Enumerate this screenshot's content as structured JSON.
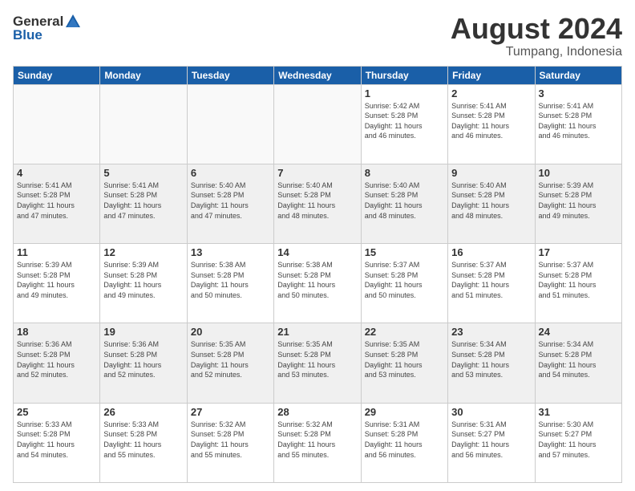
{
  "header": {
    "logo_general": "General",
    "logo_blue": "Blue",
    "month": "August 2024",
    "location": "Tumpang, Indonesia"
  },
  "days_of_week": [
    "Sunday",
    "Monday",
    "Tuesday",
    "Wednesday",
    "Thursday",
    "Friday",
    "Saturday"
  ],
  "weeks": [
    [
      {
        "day": "",
        "info": "",
        "empty": true
      },
      {
        "day": "",
        "info": "",
        "empty": true
      },
      {
        "day": "",
        "info": "",
        "empty": true
      },
      {
        "day": "",
        "info": "",
        "empty": true
      },
      {
        "day": "1",
        "info": "Sunrise: 5:42 AM\nSunset: 5:28 PM\nDaylight: 11 hours\nand 46 minutes."
      },
      {
        "day": "2",
        "info": "Sunrise: 5:41 AM\nSunset: 5:28 PM\nDaylight: 11 hours\nand 46 minutes."
      },
      {
        "day": "3",
        "info": "Sunrise: 5:41 AM\nSunset: 5:28 PM\nDaylight: 11 hours\nand 46 minutes."
      }
    ],
    [
      {
        "day": "4",
        "info": "Sunrise: 5:41 AM\nSunset: 5:28 PM\nDaylight: 11 hours\nand 47 minutes."
      },
      {
        "day": "5",
        "info": "Sunrise: 5:41 AM\nSunset: 5:28 PM\nDaylight: 11 hours\nand 47 minutes."
      },
      {
        "day": "6",
        "info": "Sunrise: 5:40 AM\nSunset: 5:28 PM\nDaylight: 11 hours\nand 47 minutes."
      },
      {
        "day": "7",
        "info": "Sunrise: 5:40 AM\nSunset: 5:28 PM\nDaylight: 11 hours\nand 48 minutes."
      },
      {
        "day": "8",
        "info": "Sunrise: 5:40 AM\nSunset: 5:28 PM\nDaylight: 11 hours\nand 48 minutes."
      },
      {
        "day": "9",
        "info": "Sunrise: 5:40 AM\nSunset: 5:28 PM\nDaylight: 11 hours\nand 48 minutes."
      },
      {
        "day": "10",
        "info": "Sunrise: 5:39 AM\nSunset: 5:28 PM\nDaylight: 11 hours\nand 49 minutes."
      }
    ],
    [
      {
        "day": "11",
        "info": "Sunrise: 5:39 AM\nSunset: 5:28 PM\nDaylight: 11 hours\nand 49 minutes."
      },
      {
        "day": "12",
        "info": "Sunrise: 5:39 AM\nSunset: 5:28 PM\nDaylight: 11 hours\nand 49 minutes."
      },
      {
        "day": "13",
        "info": "Sunrise: 5:38 AM\nSunset: 5:28 PM\nDaylight: 11 hours\nand 50 minutes."
      },
      {
        "day": "14",
        "info": "Sunrise: 5:38 AM\nSunset: 5:28 PM\nDaylight: 11 hours\nand 50 minutes."
      },
      {
        "day": "15",
        "info": "Sunrise: 5:37 AM\nSunset: 5:28 PM\nDaylight: 11 hours\nand 50 minutes."
      },
      {
        "day": "16",
        "info": "Sunrise: 5:37 AM\nSunset: 5:28 PM\nDaylight: 11 hours\nand 51 minutes."
      },
      {
        "day": "17",
        "info": "Sunrise: 5:37 AM\nSunset: 5:28 PM\nDaylight: 11 hours\nand 51 minutes."
      }
    ],
    [
      {
        "day": "18",
        "info": "Sunrise: 5:36 AM\nSunset: 5:28 PM\nDaylight: 11 hours\nand 52 minutes."
      },
      {
        "day": "19",
        "info": "Sunrise: 5:36 AM\nSunset: 5:28 PM\nDaylight: 11 hours\nand 52 minutes."
      },
      {
        "day": "20",
        "info": "Sunrise: 5:35 AM\nSunset: 5:28 PM\nDaylight: 11 hours\nand 52 minutes."
      },
      {
        "day": "21",
        "info": "Sunrise: 5:35 AM\nSunset: 5:28 PM\nDaylight: 11 hours\nand 53 minutes."
      },
      {
        "day": "22",
        "info": "Sunrise: 5:35 AM\nSunset: 5:28 PM\nDaylight: 11 hours\nand 53 minutes."
      },
      {
        "day": "23",
        "info": "Sunrise: 5:34 AM\nSunset: 5:28 PM\nDaylight: 11 hours\nand 53 minutes."
      },
      {
        "day": "24",
        "info": "Sunrise: 5:34 AM\nSunset: 5:28 PM\nDaylight: 11 hours\nand 54 minutes."
      }
    ],
    [
      {
        "day": "25",
        "info": "Sunrise: 5:33 AM\nSunset: 5:28 PM\nDaylight: 11 hours\nand 54 minutes."
      },
      {
        "day": "26",
        "info": "Sunrise: 5:33 AM\nSunset: 5:28 PM\nDaylight: 11 hours\nand 55 minutes."
      },
      {
        "day": "27",
        "info": "Sunrise: 5:32 AM\nSunset: 5:28 PM\nDaylight: 11 hours\nand 55 minutes."
      },
      {
        "day": "28",
        "info": "Sunrise: 5:32 AM\nSunset: 5:28 PM\nDaylight: 11 hours\nand 55 minutes."
      },
      {
        "day": "29",
        "info": "Sunrise: 5:31 AM\nSunset: 5:28 PM\nDaylight: 11 hours\nand 56 minutes."
      },
      {
        "day": "30",
        "info": "Sunrise: 5:31 AM\nSunset: 5:27 PM\nDaylight: 11 hours\nand 56 minutes."
      },
      {
        "day": "31",
        "info": "Sunrise: 5:30 AM\nSunset: 5:27 PM\nDaylight: 11 hours\nand 57 minutes."
      }
    ]
  ]
}
